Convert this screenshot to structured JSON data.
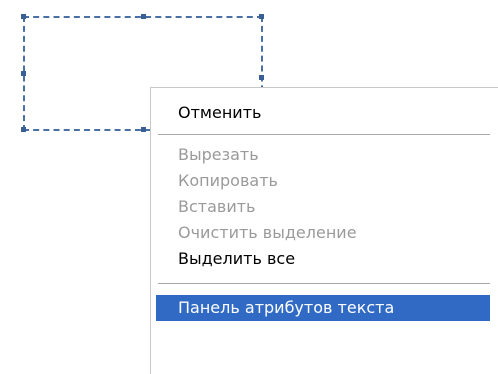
{
  "context_menu": {
    "items": [
      {
        "label": "Отменить",
        "enabled": true
      },
      {
        "label": "Вырезать",
        "enabled": false
      },
      {
        "label": "Копировать",
        "enabled": false
      },
      {
        "label": "Вставить",
        "enabled": false
      },
      {
        "label": "Очистить выделение",
        "enabled": false
      },
      {
        "label": "Выделить все",
        "enabled": true
      },
      {
        "label": "Панель атрибутов текста",
        "enabled": true,
        "highlighted": true
      }
    ]
  },
  "colors": {
    "highlight": "#316ac5",
    "disabled_text": "#9a9a9a",
    "selection_border": "#4a6fa5"
  }
}
